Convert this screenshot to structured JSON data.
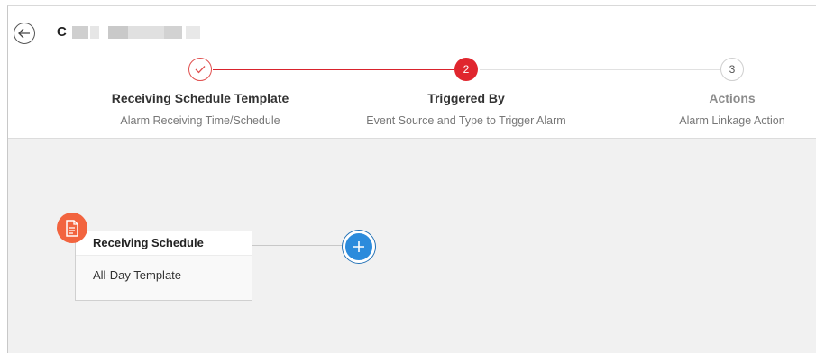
{
  "header": {
    "title_initial": "C"
  },
  "steps": [
    {
      "number": "",
      "label": "Receiving Schedule Template",
      "description": "Alarm Receiving Time/Schedule",
      "state": "done"
    },
    {
      "number": "2",
      "label": "Triggered By",
      "description": "Event Source and Type to Trigger Alarm",
      "state": "active"
    },
    {
      "number": "3",
      "label": "Actions",
      "description": "Alarm Linkage Action",
      "state": "todo"
    }
  ],
  "colors": {
    "accent_red": "#e0262e",
    "node_icon_orange": "#f2643f",
    "add_button_blue": "#2b8bdc"
  },
  "flow": {
    "node": {
      "icon": "document-icon",
      "title": "Receiving Schedule",
      "value": "All-Day Template"
    },
    "add_button_icon": "plus-icon"
  }
}
